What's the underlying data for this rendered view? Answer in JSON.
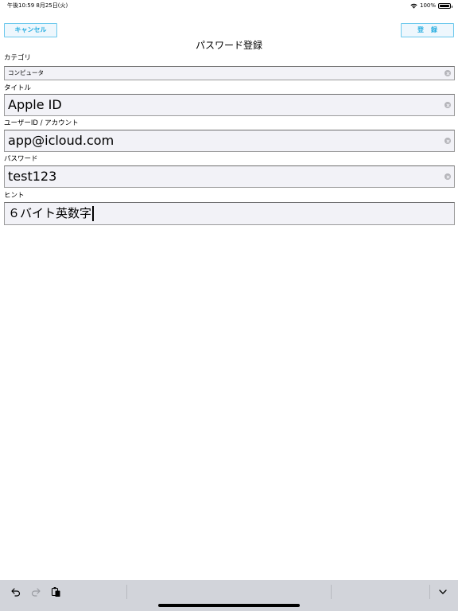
{
  "status_bar": {
    "time": "午後10:59   8月25日(火)",
    "battery_text": "100%",
    "battery_level": 1.0
  },
  "nav": {
    "cancel_label": "キャンセル",
    "register_label": "登録",
    "title": "パスワード登録"
  },
  "fields": {
    "category": {
      "label": "カテゴリ",
      "value": "コンピュータ"
    },
    "title": {
      "label": "タイトル",
      "value": "Apple ID"
    },
    "user_id": {
      "label": "ユーザーID / アカウント",
      "value": "app@icloud.com"
    },
    "password": {
      "label": "パスワード",
      "value": "test123"
    },
    "hint": {
      "label": "ヒント",
      "value": "６バイト英数字"
    }
  },
  "toolbar": {
    "icons": [
      "undo-icon",
      "redo-icon",
      "paste-icon",
      "keyboard-dismiss-icon"
    ]
  },
  "colors": {
    "accent": "#29aee0",
    "button_border": "#6bc8ec",
    "field_bg": "#f2f2f7",
    "toolbar_bg": "#d2d4da"
  }
}
